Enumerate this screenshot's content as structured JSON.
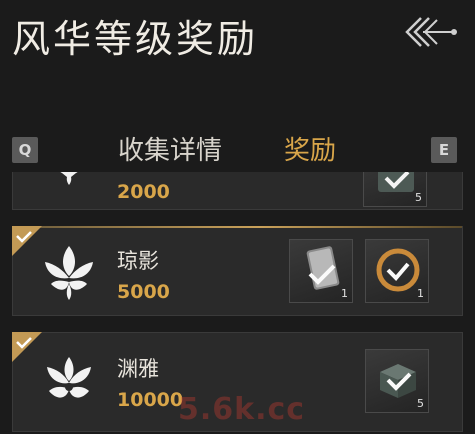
{
  "header": {
    "title": "风华等级奖励",
    "back_icon": "back-arrow-icon"
  },
  "tabs": {
    "prev_key": "Q",
    "next_key": "E",
    "items": [
      {
        "label": "收集详情",
        "active": false
      },
      {
        "label": "奖励",
        "active": true
      }
    ]
  },
  "levels": [
    {
      "name": "",
      "requirement": "2000",
      "claimed": false,
      "emblem_icon": "flower-emblem-icon",
      "rewards": [
        {
          "icon": "material-box-icon",
          "count": "5"
        }
      ]
    },
    {
      "name": "琼影",
      "requirement": "5000",
      "claimed": true,
      "emblem_icon": "flower-emblem-icon",
      "rewards": [
        {
          "icon": "scroll-icon",
          "count": "1"
        },
        {
          "icon": "ring-icon",
          "count": "1"
        }
      ]
    },
    {
      "name": "渊雅",
      "requirement": "10000",
      "claimed": true,
      "emblem_icon": "flower-emblem-icon",
      "rewards": [
        {
          "icon": "material-box-icon",
          "count": "5"
        }
      ]
    }
  ],
  "watermark": "5.6k.cc",
  "colors": {
    "accent_gold": "#d9a64a",
    "background": "#1b1b1b",
    "card": "#2a2a2a"
  }
}
